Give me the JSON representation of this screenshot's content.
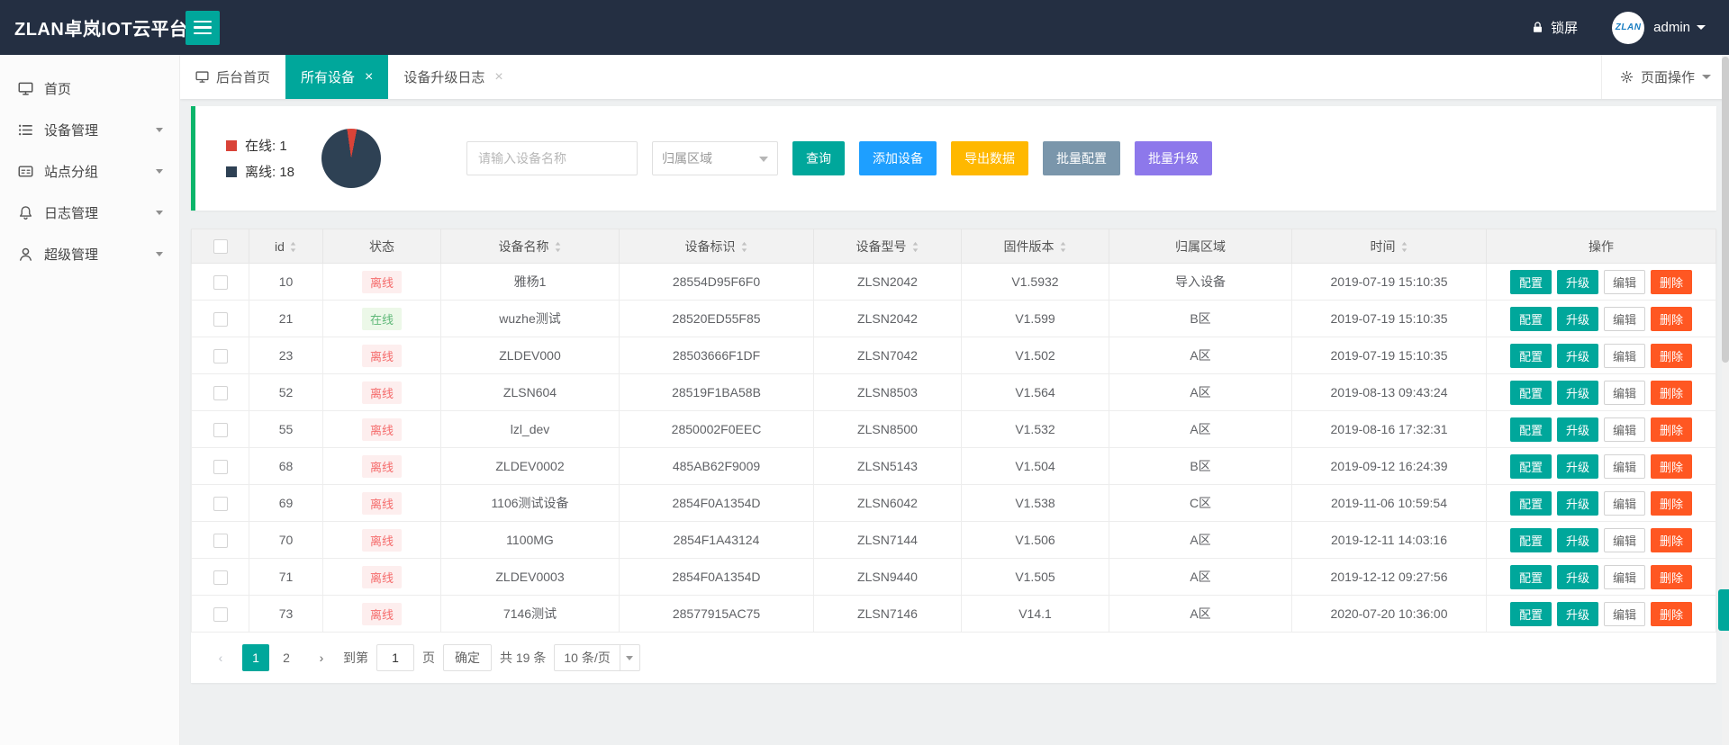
{
  "app": {
    "brand": "ZLAN卓岚IOT云平台"
  },
  "colors": {
    "topbar": "#242f42",
    "teal": "#00a79b",
    "green": "#0ab56a",
    "blue": "#1e9fff",
    "orange": "#ffb800",
    "slate": "#7a96ab",
    "purple": "#8d78eb",
    "danger": "#ff5722"
  },
  "topbar": {
    "lock_label": "锁屏",
    "logo_text": "ZLAN",
    "username": "admin"
  },
  "sidebar": {
    "items": [
      {
        "key": "home",
        "label": "首页",
        "icon": "monitor-icon",
        "has_arrow": false
      },
      {
        "key": "device-management",
        "label": "设备管理",
        "icon": "list-icon",
        "has_arrow": true
      },
      {
        "key": "site-grouping",
        "label": "站点分组",
        "icon": "card-icon",
        "has_arrow": true
      },
      {
        "key": "log-management",
        "label": "日志管理",
        "icon": "bell-icon",
        "has_arrow": true
      },
      {
        "key": "super-management",
        "label": "超级管理",
        "icon": "user-icon",
        "has_arrow": true
      }
    ]
  },
  "tabs": {
    "items": [
      {
        "key": "backend-home",
        "label": "后台首页",
        "icon": "monitor-icon",
        "active": false,
        "closable": false
      },
      {
        "key": "all-devices",
        "label": "所有设备",
        "active": true,
        "closable": true
      },
      {
        "key": "device-upgrade-log",
        "label": "设备升级日志",
        "active": false,
        "closable": true
      }
    ],
    "page_ops_label": "页面操作"
  },
  "stats": {
    "online_label": "在线: 1",
    "offline_label": "离线: 18"
  },
  "chart_data": {
    "type": "pie",
    "labels": [
      "在线",
      "离线"
    ],
    "values": [
      1,
      18
    ],
    "colors": [
      "#d94338",
      "#2e4154"
    ],
    "legend_position": "left"
  },
  "filters": {
    "name_placeholder": "请输入设备名称",
    "region_value": "归属区域",
    "search_label": "查询",
    "add_label": "添加设备",
    "export_label": "导出数据",
    "batch_config_label": "批量配置",
    "batch_upgrade_label": "批量升级"
  },
  "table": {
    "columns": [
      {
        "key": "id",
        "label": "id",
        "sortable": true
      },
      {
        "key": "status",
        "label": "状态",
        "sortable": false
      },
      {
        "key": "device-name",
        "label": "设备名称",
        "sortable": true
      },
      {
        "key": "device-ident",
        "label": "设备标识",
        "sortable": true
      },
      {
        "key": "device-model",
        "label": "设备型号",
        "sortable": true
      },
      {
        "key": "firmware-version",
        "label": "固件版本",
        "sortable": true
      },
      {
        "key": "region",
        "label": "归属区域",
        "sortable": false
      },
      {
        "key": "time",
        "label": "时间",
        "sortable": true
      },
      {
        "key": "actions",
        "label": "操作",
        "sortable": false
      }
    ],
    "actions": [
      {
        "name": "config",
        "label": "配置",
        "style": "teal"
      },
      {
        "name": "upgrade",
        "label": "升级",
        "style": "teal"
      },
      {
        "name": "edit",
        "label": "编辑",
        "style": "plain"
      },
      {
        "name": "delete",
        "label": "删除",
        "style": "danger"
      }
    ],
    "rows": [
      {
        "id": "10",
        "status": "离线",
        "status_type": "offline",
        "name": "雅杨1",
        "ident": "28554D95F6F0",
        "model": "ZLSN2042",
        "firmware": "V1.5932",
        "region": "导入设备",
        "time": "2019-07-19 15:10:35"
      },
      {
        "id": "21",
        "status": "在线",
        "status_type": "online",
        "name": "wuzhe测试",
        "ident": "28520ED55F85",
        "model": "ZLSN2042",
        "firmware": "V1.599",
        "region": "B区",
        "time": "2019-07-19 15:10:35"
      },
      {
        "id": "23",
        "status": "离线",
        "status_type": "offline",
        "name": "ZLDEV000",
        "ident": "28503666F1DF",
        "model": "ZLSN7042",
        "firmware": "V1.502",
        "region": "A区",
        "time": "2019-07-19 15:10:35"
      },
      {
        "id": "52",
        "status": "离线",
        "status_type": "offline",
        "name": "ZLSN604",
        "ident": "28519F1BA58B",
        "model": "ZLSN8503",
        "firmware": "V1.564",
        "region": "A区",
        "time": "2019-08-13 09:43:24"
      },
      {
        "id": "55",
        "status": "离线",
        "status_type": "offline",
        "name": "lzl_dev",
        "ident": "2850002F0EEC",
        "model": "ZLSN8500",
        "firmware": "V1.532",
        "region": "A区",
        "time": "2019-08-16 17:32:31"
      },
      {
        "id": "68",
        "status": "离线",
        "status_type": "offline",
        "name": "ZLDEV0002",
        "ident": "485AB62F9009",
        "model": "ZLSN5143",
        "firmware": "V1.504",
        "region": "B区",
        "time": "2019-09-12 16:24:39"
      },
      {
        "id": "69",
        "status": "离线",
        "status_type": "offline",
        "name": "1106测试设备",
        "ident": "2854F0A1354D",
        "model": "ZLSN6042",
        "firmware": "V1.538",
        "region": "C区",
        "time": "2019-11-06 10:59:54"
      },
      {
        "id": "70",
        "status": "离线",
        "status_type": "offline",
        "name": "1100MG",
        "ident": "2854F1A43124",
        "model": "ZLSN7144",
        "firmware": "V1.506",
        "region": "A区",
        "time": "2019-12-11 14:03:16"
      },
      {
        "id": "71",
        "status": "离线",
        "status_type": "offline",
        "name": "ZLDEV0003",
        "ident": "2854F0A1354D",
        "model": "ZLSN9440",
        "firmware": "V1.505",
        "region": "A区",
        "time": "2019-12-12 09:27:56"
      },
      {
        "id": "73",
        "status": "离线",
        "status_type": "offline",
        "name": "7146测试",
        "ident": "28577915AC75",
        "model": "ZLSN7146",
        "firmware": "V14.1",
        "region": "A区",
        "time": "2020-07-20 10:36:00"
      }
    ]
  },
  "pagination": {
    "prev_label": "‹",
    "next_label": "›",
    "pages": [
      "1",
      "2"
    ],
    "active_page": "1",
    "goto_text": "到第",
    "goto_value": "1",
    "page_text": "页",
    "confirm_label": "确定",
    "total_label": "共 19 条",
    "size_label": "10 条/页"
  }
}
